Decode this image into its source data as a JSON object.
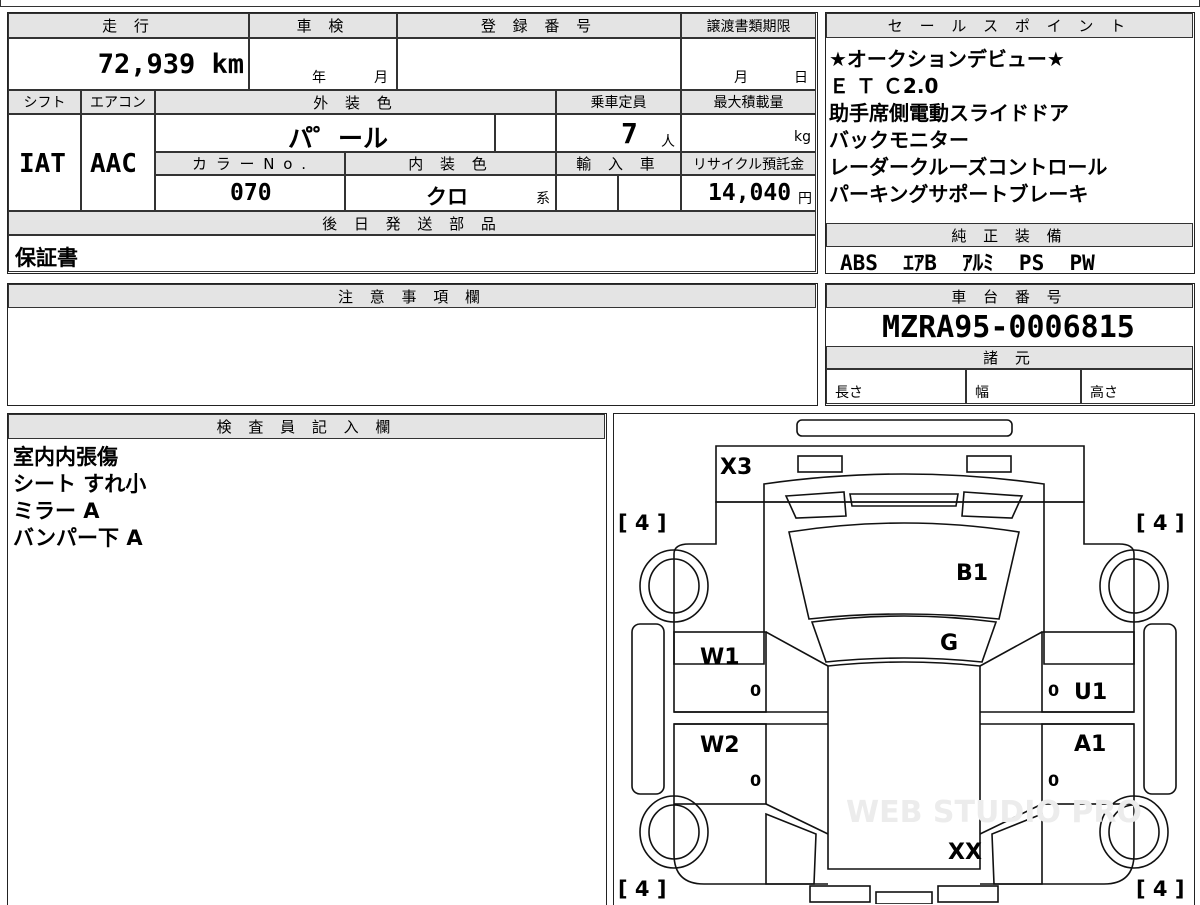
{
  "top_partial": {
    "text1": "",
    "text2": ""
  },
  "main": {
    "mileage": {
      "label": "走 行",
      "value": "72,939 km"
    },
    "inspection": {
      "label": "車 検",
      "year_label": "年",
      "month_label": "月"
    },
    "registration": {
      "label": "登 録 番 号",
      "value": ""
    },
    "transfer_deadline": {
      "label": "譲渡書類期限",
      "month_label": "月",
      "day_label": "日"
    },
    "shift": {
      "label": "シフト",
      "value": "IAT"
    },
    "aircon": {
      "label": "エアコン",
      "value": "AAC"
    },
    "exterior_color": {
      "label": "外 装 色",
      "value": "パ゜ール"
    },
    "capacity": {
      "label": "乗車定員",
      "value": "7",
      "unit": "人"
    },
    "max_load": {
      "label": "最大積載量",
      "unit": "kg"
    },
    "color_no": {
      "label": "カ ラ ー N o .",
      "value": "070"
    },
    "interior_color": {
      "label": "内 装 色",
      "value": "クロ",
      "suffix": "系"
    },
    "import": {
      "label": "輸 入 車"
    },
    "recycle": {
      "label": "リサイクル預託金",
      "value": "14,040",
      "unit": "円"
    },
    "later_parts": {
      "label": "後 日 発 送 部 品",
      "value": "保証書"
    }
  },
  "sales_points": {
    "label": "セ ー ル ス ポ イ ン ト",
    "items": [
      "★オークションデビュー★",
      "Ｅ Ｔ Ｃ2.0",
      "助手席側電動スライドドア",
      "バックモニター",
      "レーダークルーズコントロール",
      "パーキングサポートブレーキ"
    ]
  },
  "equipment": {
    "label": "純 正 装 備",
    "value": "ABS  ｴｱB  ｱﾙﾐ  PS  PW"
  },
  "notes": {
    "label": "注 意 事 項 欄",
    "value": ""
  },
  "chassis": {
    "label": "車 台 番 号",
    "value": "MZRA95-0006815"
  },
  "specs": {
    "label": "諸 元",
    "length": "長さ",
    "width": "幅",
    "height": "高さ"
  },
  "inspector": {
    "label": "検 査 員 記 入 欄",
    "items": [
      "室内内張傷",
      "シート すれ小",
      "ミラー A",
      "バンパー下 A"
    ]
  },
  "diagram": {
    "x3": "X3",
    "b1": "B1",
    "g": "G",
    "w1": "W1",
    "w2": "W2",
    "u1": "U1",
    "a1": "A1",
    "xx": "XX",
    "tire_tl": "[ 4 ]",
    "tire_tr": "[ 4 ]",
    "tire_bl": "[ 4 ]",
    "tire_br": "[ 4 ]",
    "zero_w1": "0",
    "zero_w2": "0",
    "zero_u1": "0",
    "zero_a1": "0",
    "watermark": "WEB STUDIO PRO"
  }
}
